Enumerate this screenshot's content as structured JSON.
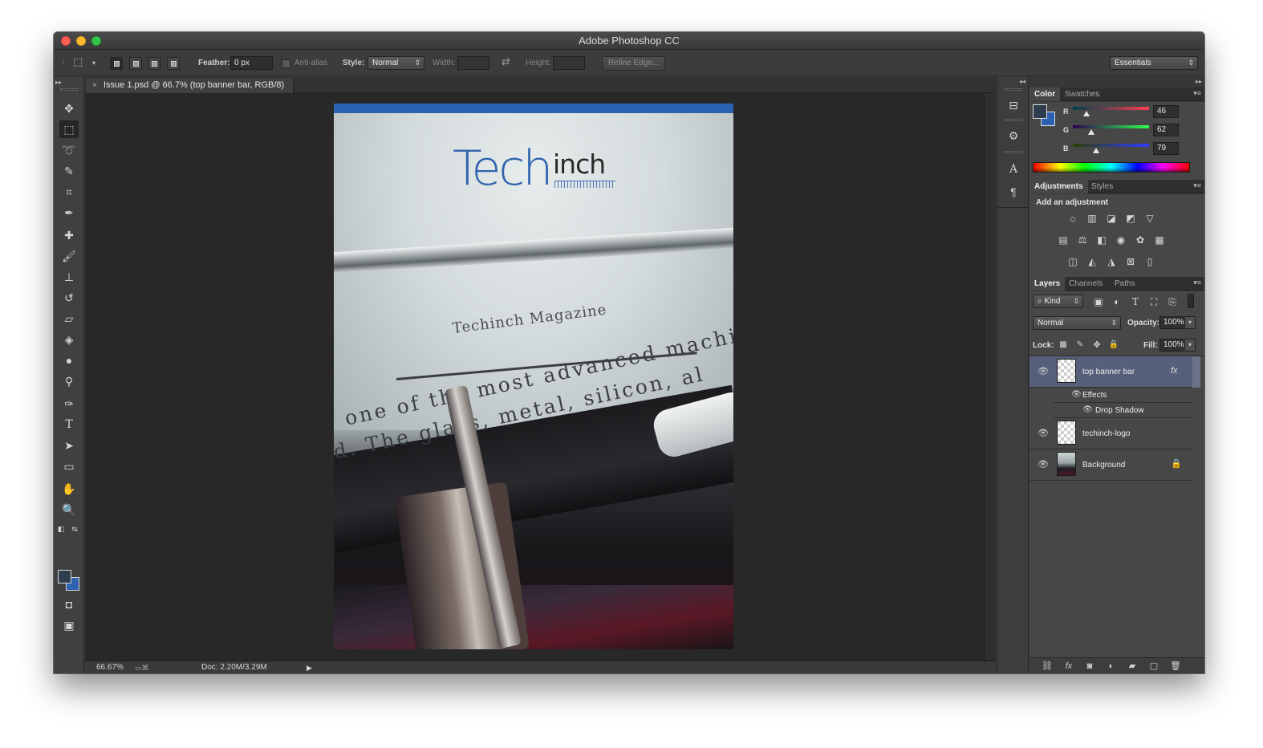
{
  "window": {
    "title": "Adobe Photoshop CC"
  },
  "options_bar": {
    "feather_label": "Feather:",
    "feather_value": "0 px",
    "antialias_label": "Anti-alias",
    "style_label": "Style:",
    "style_value": "Normal",
    "width_label": "Width:",
    "height_label": "Height:",
    "refine_edge_label": "Refine Edge...",
    "workspace": "Essentials"
  },
  "document": {
    "tab_title": "Issue 1.psd @ 66.7% (top banner bar, RGB/8)",
    "tab_close": "×",
    "canvas": {
      "logo_tech": "Tech",
      "logo_inch": "inch",
      "typed_heading": "Techinch Magazine",
      "typed_line1": "one of the most advanced machin",
      "typed_line2": "d. The glass, metal, silicon, al"
    },
    "status": {
      "zoom": "66.67%",
      "doc_size": "Doc: 2.20M/3.29M"
    }
  },
  "color_panel": {
    "tabs": [
      "Color",
      "Swatches"
    ],
    "r_label": "R",
    "g_label": "G",
    "b_label": "B",
    "r": 46,
    "g": 62,
    "b": 79,
    "fg_color": "#2e3e4f",
    "bg_color": "#2d62b0"
  },
  "adjustments_panel": {
    "tabs": [
      "Adjustments",
      "Styles"
    ],
    "title": "Add an adjustment"
  },
  "layers_panel": {
    "tabs": [
      "Layers",
      "Channels",
      "Paths"
    ],
    "filter_label": "Kind",
    "blend_mode": "Normal",
    "opacity_label": "Opacity:",
    "opacity": "100%",
    "lock_label": "Lock:",
    "fill_label": "Fill:",
    "fill": "100%",
    "fx_badge": "fx",
    "layers": [
      {
        "name": "top banner bar",
        "selected": true,
        "has_fx": true
      },
      {
        "name": "techinch-logo",
        "selected": false,
        "has_fx": false
      },
      {
        "name": "Background",
        "selected": false,
        "locked": true
      }
    ],
    "effects_label": "Effects",
    "drop_shadow_label": "Drop Shadow"
  },
  "colors": {
    "banner": "#2b63b3",
    "selected_layer": "#56607a"
  }
}
